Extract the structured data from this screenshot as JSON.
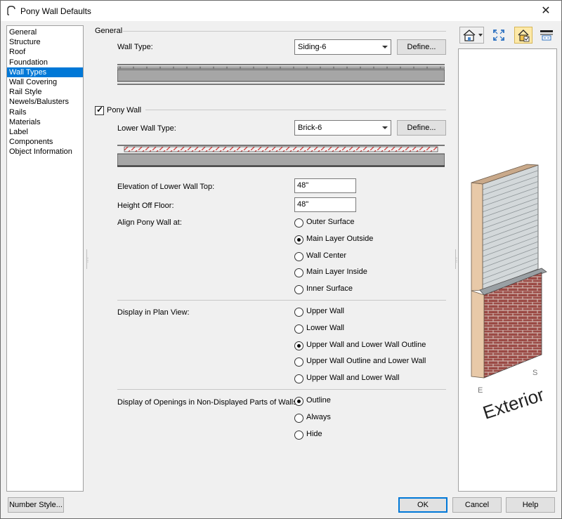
{
  "window": {
    "title": "Pony Wall Defaults",
    "close_glyph": "✕"
  },
  "sidebar": {
    "items": [
      {
        "label": "General",
        "selected": false
      },
      {
        "label": "Structure",
        "selected": false
      },
      {
        "label": "Roof",
        "selected": false
      },
      {
        "label": "Foundation",
        "selected": false
      },
      {
        "label": "Wall Types",
        "selected": true
      },
      {
        "label": "Wall Covering",
        "selected": false
      },
      {
        "label": "Rail Style",
        "selected": false
      },
      {
        "label": "Newels/Balusters",
        "selected": false
      },
      {
        "label": "Rails",
        "selected": false
      },
      {
        "label": "Materials",
        "selected": false
      },
      {
        "label": "Label",
        "selected": false
      },
      {
        "label": "Components",
        "selected": false
      },
      {
        "label": "Object Information",
        "selected": false
      }
    ]
  },
  "general": {
    "group_title": "General",
    "wall_type_label": "Wall Type:",
    "wall_type_value": "Siding-6",
    "define_label": "Define..."
  },
  "pony": {
    "checkbox_label": "Pony Wall",
    "checked": true,
    "lower_wall_type_label": "Lower Wall Type:",
    "lower_wall_type_value": "Brick-6",
    "define_label": "Define...",
    "elevation_label": "Elevation of Lower Wall Top:",
    "elevation_value": "48\"",
    "height_label": "Height Off Floor:",
    "height_value": "48\"",
    "align_label": "Align Pony Wall at:",
    "align_options": [
      {
        "label": "Outer Surface",
        "selected": false
      },
      {
        "label": "Main Layer Outside",
        "selected": true
      },
      {
        "label": "Wall Center",
        "selected": false
      },
      {
        "label": "Main Layer Inside",
        "selected": false
      },
      {
        "label": "Inner Surface",
        "selected": false
      }
    ],
    "display_label": "Display in Plan View:",
    "display_options": [
      {
        "label": "Upper Wall",
        "selected": false
      },
      {
        "label": "Lower Wall",
        "selected": false
      },
      {
        "label": "Upper Wall and Lower Wall Outline",
        "selected": true
      },
      {
        "label": "Upper Wall Outline and Lower Wall",
        "selected": false
      },
      {
        "label": "Upper Wall and Lower Wall",
        "selected": false
      }
    ],
    "openings_label": "Display of Openings in Non-Displayed Parts of Walls:",
    "openings_options": [
      {
        "label": "Outline",
        "selected": true
      },
      {
        "label": "Always",
        "selected": false
      },
      {
        "label": "Hide",
        "selected": false
      }
    ]
  },
  "preview": {
    "exterior_label": "Exterior",
    "compass_e": "E",
    "compass_s": "S",
    "toolbar_icons": [
      "house-view-icon",
      "fill-window-icon",
      "material-view-icon",
      "wall-section-icon"
    ]
  },
  "footer": {
    "number_style_label": "Number Style...",
    "ok_label": "OK",
    "cancel_label": "Cancel",
    "help_label": "Help"
  },
  "colors": {
    "selection": "#0078d7",
    "siding": "#d3d8da",
    "brick": "#9b4a45",
    "trim": "#e8c9a8",
    "cap": "#9aa0a4",
    "hatch": "#d23a3a"
  }
}
